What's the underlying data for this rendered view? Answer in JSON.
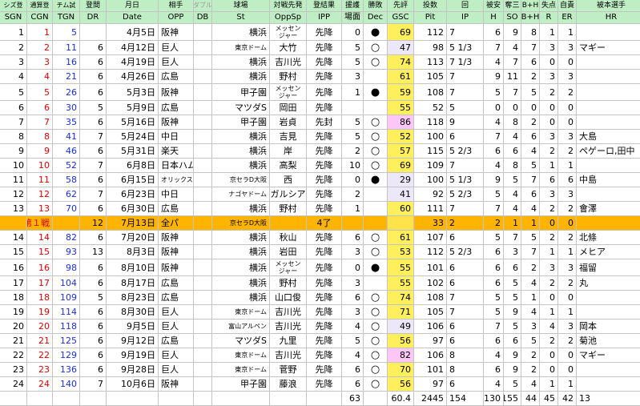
{
  "header_top": [
    "シズ登",
    "通算登",
    "チム試",
    "登間",
    "月日",
    "相手",
    "ダブル",
    "球場",
    "対戦先発",
    "登結果",
    "援護",
    "勝敗",
    "先評",
    "投数",
    "回",
    "被安",
    "奪三",
    "B+H",
    "失点",
    "自責",
    "被本選手"
  ],
  "header_bottom": [
    "SGN",
    "CGN",
    "TGN",
    "DR",
    "Date",
    "OPP",
    "DB",
    "St",
    "OppSp",
    "IPP",
    "場面",
    "Dec",
    "GSC",
    "Pit",
    "IP",
    "H",
    "SO",
    "B+H",
    "R",
    "ER",
    "HR"
  ],
  "colors": {
    "header_bg": "#bfeec4",
    "allstar_bg": "#ffb400",
    "gsc_default": "#ece8fa",
    "gsc_high": "#ffef5c",
    "gsc_top": "#fbc7f6",
    "cgn_red": "#e00000",
    "tgn_blue": "#1a2fd6"
  },
  "rows": [
    {
      "sgn": "1",
      "cgn": "1",
      "tgn": "5",
      "dr": "",
      "date": "4月5日",
      "opp": "阪神",
      "db": "",
      "st": "横浜",
      "oppsp": "メッセン\nジャー",
      "ipp": "先降",
      "situ": "0",
      "dec": "●",
      "gsc": "69",
      "pit": "112",
      "ip": "7",
      "h": "6",
      "so": "9",
      "bh": "8",
      "r": "1",
      "er": "1",
      "hr": ""
    },
    {
      "sgn": "2",
      "cgn": "2",
      "tgn": "11",
      "dr": "6",
      "date": "4月12日",
      "opp": "巨人",
      "db": "",
      "st": "東京ドーム",
      "oppsp": "大竹",
      "ipp": "先降",
      "situ": "5",
      "dec": "○",
      "gsc": "47",
      "pit": "98",
      "ip": "5 1/3",
      "h": "7",
      "so": "4",
      "bh": "7",
      "r": "3",
      "er": "3",
      "hr": "マギー"
    },
    {
      "sgn": "3",
      "cgn": "3",
      "tgn": "16",
      "dr": "6",
      "date": "4月19日",
      "opp": "巨人",
      "db": "",
      "st": "横浜",
      "oppsp": "吉川光",
      "ipp": "先降",
      "situ": "5",
      "dec": "○",
      "gsc": "74",
      "pit": "113",
      "ip": "7 1/3",
      "h": "4",
      "so": "7",
      "bh": "6",
      "r": "0",
      "er": "0",
      "hr": ""
    },
    {
      "sgn": "4",
      "cgn": "4",
      "tgn": "21",
      "dr": "6",
      "date": "4月26日",
      "opp": "広島",
      "db": "",
      "st": "横浜",
      "oppsp": "野村",
      "ipp": "先降",
      "situ": "3",
      "dec": "",
      "gsc": "61",
      "pit": "105",
      "ip": "7",
      "h": "9",
      "so": "11",
      "bh": "2",
      "r": "3",
      "er": "3",
      "hr": ""
    },
    {
      "sgn": "5",
      "cgn": "5",
      "tgn": "26",
      "dr": "6",
      "date": "5月3日",
      "opp": "阪神",
      "db": "",
      "st": "甲子園",
      "oppsp": "メッセン\nジャー",
      "ipp": "先降",
      "situ": "1",
      "dec": "●",
      "gsc": "59",
      "pit": "108",
      "ip": "7",
      "h": "5",
      "so": "7",
      "bh": "5",
      "r": "2",
      "er": "2",
      "hr": ""
    },
    {
      "sgn": "6",
      "cgn": "6",
      "tgn": "30",
      "dr": "5",
      "date": "5月9日",
      "opp": "広島",
      "db": "",
      "st": "マツダS",
      "oppsp": "岡田",
      "ipp": "先降",
      "situ": "",
      "dec": "",
      "gsc": "55",
      "pit": "52",
      "ip": "5",
      "h": "0",
      "so": "0",
      "bh": "0",
      "r": "0",
      "er": "0",
      "hr": ""
    },
    {
      "sgn": "7",
      "cgn": "7",
      "tgn": "35",
      "dr": "6",
      "date": "5月16日",
      "opp": "阪神",
      "db": "",
      "st": "甲子園",
      "oppsp": "岩貞",
      "ipp": "先封",
      "situ": "5",
      "dec": "○",
      "gsc": "86",
      "pit": "118",
      "ip": "9",
      "h": "4",
      "so": "8",
      "bh": "2",
      "r": "0",
      "er": "0",
      "hr": ""
    },
    {
      "sgn": "8",
      "cgn": "8",
      "tgn": "41",
      "dr": "7",
      "date": "5月24日",
      "opp": "中日",
      "db": "",
      "st": "横浜",
      "oppsp": "吉見",
      "ipp": "先降",
      "situ": "5",
      "dec": "○",
      "gsc": "52",
      "pit": "100",
      "ip": "6",
      "h": "7",
      "so": "4",
      "bh": "6",
      "r": "3",
      "er": "3",
      "hr": "大島"
    },
    {
      "sgn": "9",
      "cgn": "9",
      "tgn": "46",
      "dr": "6",
      "date": "5月31日",
      "opp": "楽天",
      "db": "",
      "st": "横浜",
      "oppsp": "岸",
      "ipp": "先降",
      "situ": "2",
      "dec": "○",
      "gsc": "57",
      "pit": "115",
      "ip": "5 2/3",
      "h": "6",
      "so": "6",
      "bh": "4",
      "r": "2",
      "er": "2",
      "hr": "ペゲーロ,田中"
    },
    {
      "sgn": "10",
      "cgn": "10",
      "tgn": "52",
      "dr": "7",
      "date": "6月8日",
      "opp": "日本ハム",
      "db": "",
      "st": "横浜",
      "oppsp": "高梨",
      "ipp": "先降",
      "situ": "10",
      "dec": "○",
      "gsc": "69",
      "pit": "109",
      "ip": "7",
      "h": "4",
      "so": "8",
      "bh": "5",
      "r": "1",
      "er": "1",
      "hr": ""
    },
    {
      "sgn": "11",
      "cgn": "11",
      "tgn": "58",
      "dr": "6",
      "date": "6月15日",
      "opp": "オリックス",
      "db": "",
      "st": "京セラD大阪",
      "oppsp": "西",
      "ipp": "先降",
      "situ": "0",
      "dec": "●",
      "gsc": "29",
      "pit": "100",
      "ip": "5 1/3",
      "h": "9",
      "so": "5",
      "bh": "7",
      "r": "6",
      "er": "6",
      "hr": "中島"
    },
    {
      "sgn": "12",
      "cgn": "12",
      "tgn": "62",
      "dr": "7",
      "date": "6月23日",
      "opp": "中日",
      "db": "",
      "st": "ナゴヤドーム",
      "oppsp": "ガルシア",
      "ipp": "先降",
      "situ": "2",
      "dec": "",
      "gsc": "41",
      "pit": "92",
      "ip": "5 2/3",
      "h": "5",
      "so": "4",
      "bh": "6",
      "r": "3",
      "er": "3",
      "hr": ""
    },
    {
      "sgn": "13",
      "cgn": "13",
      "tgn": "70",
      "dr": "6",
      "date": "6月30日",
      "opp": "広島",
      "db": "",
      "st": "横浜",
      "oppsp": "野村",
      "ipp": "先降",
      "situ": "1",
      "dec": "",
      "gsc": "60",
      "pit": "111",
      "ip": "7",
      "h": "7",
      "so": "4",
      "bh": "4",
      "r": "2",
      "er": "2",
      "hr": "會澤"
    },
    {
      "allstar": true,
      "sgn": "",
      "cgn": "第１戦",
      "tgn": "",
      "dr": "12",
      "date": "7月13日",
      "opp": "全パ",
      "db": "",
      "st": "京セラD大阪",
      "oppsp": "",
      "ipp": "4了",
      "situ": "",
      "dec": "",
      "gsc": "",
      "pit": "33",
      "ip": "2",
      "h": "2",
      "so": "1",
      "bh": "1",
      "r": "0",
      "er": "0",
      "hr": ""
    },
    {
      "sgn": "14",
      "cgn": "14",
      "tgn": "82",
      "dr": "6",
      "date": "7月20日",
      "opp": "阪神",
      "db": "",
      "st": "横浜",
      "oppsp": "秋山",
      "ipp": "先降",
      "situ": "6",
      "dec": "○",
      "gsc": "61",
      "pit": "107",
      "ip": "6",
      "h": "5",
      "so": "7",
      "bh": "5",
      "r": "2",
      "er": "2",
      "hr": "北條"
    },
    {
      "sgn": "15",
      "cgn": "15",
      "tgn": "93",
      "dr": "13",
      "date": "8月3日",
      "opp": "阪神",
      "db": "",
      "st": "横浜",
      "oppsp": "岩田",
      "ipp": "先降",
      "situ": "3",
      "dec": "○",
      "gsc": "53",
      "pit": "112",
      "ip": "5 2/3",
      "h": "6",
      "so": "3",
      "bh": "7",
      "r": "1",
      "er": "1",
      "hr": "メヒア"
    },
    {
      "sgn": "16",
      "cgn": "16",
      "tgn": "98",
      "dr": "6",
      "date": "8月10日",
      "opp": "阪神",
      "db": "",
      "st": "横浜",
      "oppsp": "メッセン\nジャー",
      "ipp": "先降",
      "situ": "0",
      "dec": "●",
      "gsc": "55",
      "pit": "101",
      "ip": "6",
      "h": "6",
      "so": "6",
      "bh": "2",
      "r": "3",
      "er": "3",
      "hr": "福留"
    },
    {
      "sgn": "17",
      "cgn": "17",
      "tgn": "104",
      "dr": "6",
      "date": "8月17日",
      "opp": "広島",
      "db": "",
      "st": "横浜",
      "oppsp": "野村",
      "ipp": "先降",
      "situ": "3",
      "dec": "",
      "gsc": "55",
      "pit": "102",
      "ip": "6",
      "h": "6",
      "so": "5",
      "bh": "4",
      "r": "2",
      "er": "2",
      "hr": "丸"
    },
    {
      "sgn": "18",
      "cgn": "18",
      "tgn": "109",
      "dr": "5",
      "date": "8月23日",
      "opp": "広島",
      "db": "",
      "st": "横浜",
      "oppsp": "山口俊",
      "ipp": "先降",
      "situ": "6",
      "dec": "○",
      "gsc": "74",
      "pit": "108",
      "ip": "7",
      "h": "5",
      "so": "5",
      "bh": "1",
      "r": "0",
      "er": "0",
      "hr": ""
    },
    {
      "sgn": "19",
      "cgn": "19",
      "tgn": "114",
      "dr": "6",
      "date": "8月30日",
      "opp": "巨人",
      "db": "",
      "st": "東京ドーム",
      "oppsp": "吉川光",
      "ipp": "先降",
      "situ": "3",
      "dec": "○",
      "gsc": "71",
      "pit": "105",
      "ip": "7",
      "h": "5",
      "so": "9",
      "bh": "4",
      "r": "1",
      "er": "1",
      "hr": ""
    },
    {
      "sgn": "20",
      "cgn": "20",
      "tgn": "118",
      "dr": "6",
      "date": "9月5日",
      "opp": "巨人",
      "db": "",
      "st": "富山アルペン",
      "oppsp": "吉川光",
      "ipp": "先降",
      "situ": "4",
      "dec": "○",
      "gsc": "49",
      "pit": "106",
      "ip": "6",
      "h": "7",
      "so": "5",
      "bh": "3",
      "r": "4",
      "er": "3",
      "hr": "岡本"
    },
    {
      "sgn": "21",
      "cgn": "21",
      "tgn": "125",
      "dr": "6",
      "date": "9月12日",
      "opp": "広島",
      "db": "",
      "st": "マツダS",
      "oppsp": "九里",
      "ipp": "先降",
      "situ": "5",
      "dec": "○",
      "gsc": "56",
      "pit": "97",
      "ip": "6",
      "h": "6",
      "so": "6",
      "bh": "5",
      "r": "2",
      "er": "2",
      "hr": "菊池"
    },
    {
      "sgn": "22",
      "cgn": "22",
      "tgn": "129",
      "dr": "6",
      "date": "9月19日",
      "opp": "巨人",
      "db": "",
      "st": "東京ドーム",
      "oppsp": "吉川光",
      "ipp": "先降",
      "situ": "4",
      "dec": "○",
      "gsc": "82",
      "pit": "106",
      "ip": "8",
      "h": "4",
      "so": "9",
      "bh": "2",
      "r": "0",
      "er": "0",
      "hr": "マギー"
    },
    {
      "sgn": "23",
      "cgn": "23",
      "tgn": "136",
      "dr": "6",
      "date": "9月28日",
      "opp": "巨人",
      "db": "",
      "st": "東京ドーム",
      "oppsp": "菅野",
      "ipp": "先降",
      "situ": "6",
      "dec": "○",
      "gsc": "70",
      "pit": "101",
      "ip": "8",
      "h": "6",
      "so": "9",
      "bh": "2",
      "r": "0",
      "er": "0",
      "hr": ""
    },
    {
      "sgn": "24",
      "cgn": "24",
      "tgn": "140",
      "dr": "7",
      "date": "10月6日",
      "opp": "阪神",
      "db": "",
      "st": "甲子園",
      "oppsp": "藤浪",
      "ipp": "先降",
      "situ": "6",
      "dec": "○",
      "gsc": "56",
      "pit": "97",
      "ip": "6",
      "h": "4",
      "so": "5",
      "bh": "4",
      "r": "1",
      "er": "1",
      "hr": ""
    },
    {
      "totals": true,
      "sgn": "",
      "cgn": "",
      "tgn": "",
      "dr": "",
      "date": "",
      "opp": "",
      "db": "",
      "st": "",
      "oppsp": "",
      "ipp": "",
      "situ": "63",
      "dec": "",
      "gsc": "60.4",
      "pit": "2445",
      "ip": "154",
      "h": "130",
      "so": "155",
      "bh": "44",
      "r": "45",
      "er": "42",
      "hr": "13"
    }
  ]
}
